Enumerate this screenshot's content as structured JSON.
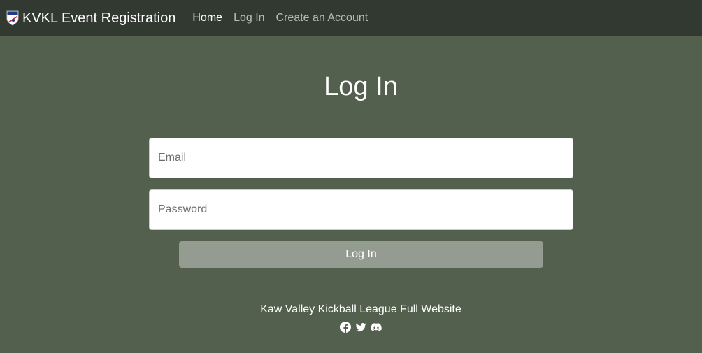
{
  "navbar": {
    "brand_title": "KVKL Event Registration",
    "logo_icon": "kvkl-shield-logo-icon",
    "links": [
      {
        "label": "Home",
        "active": true
      },
      {
        "label": "Log In",
        "active": false
      },
      {
        "label": "Create an Account",
        "active": false
      }
    ]
  },
  "main": {
    "title": "Log In",
    "email": {
      "placeholder": "Email",
      "value": ""
    },
    "password": {
      "placeholder": "Password",
      "value": ""
    },
    "submit_label": "Log In"
  },
  "footer": {
    "site_link_label": "Kaw Valley Kickball League Full Website",
    "social_icons": [
      "facebook-icon",
      "twitter-icon",
      "discord-icon"
    ]
  },
  "colors": {
    "navbar_bg": "#323931",
    "page_bg": "#52604d",
    "button_bg": "#949c91",
    "nav_inactive": "#b9bcb4",
    "text": "#ffffff"
  }
}
